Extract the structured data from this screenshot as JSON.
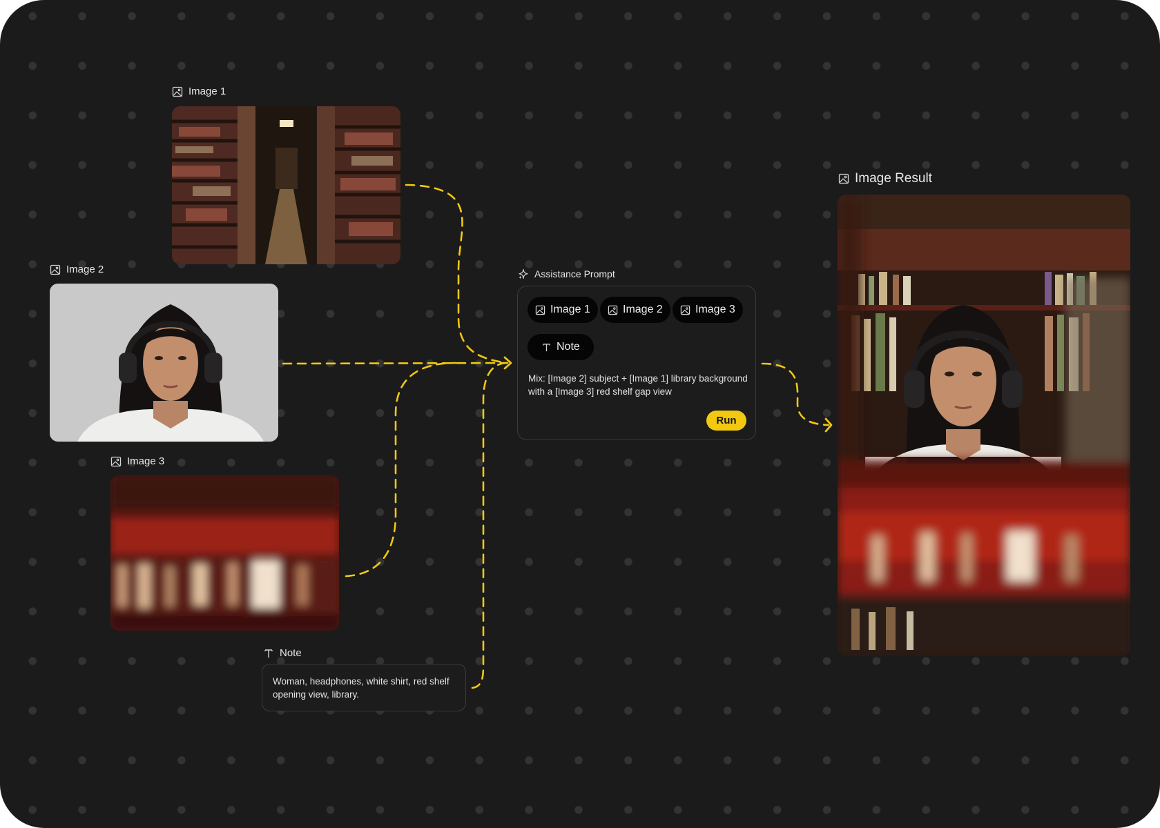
{
  "colors": {
    "canvas": "#1b1b1b",
    "dot": "#333333",
    "wire": "#f2c811",
    "accent": "#f2c811",
    "card_border": "#3c3c3c"
  },
  "nodes": {
    "image1": {
      "label": "Image 1",
      "icon": "image-icon"
    },
    "image2": {
      "label": "Image 2",
      "icon": "image-icon"
    },
    "image3": {
      "label": "Image 3",
      "icon": "image-icon"
    },
    "note": {
      "label": "Note",
      "icon": "text-icon",
      "text": "Woman, headphones, white shirt, red shelf opening view, library."
    },
    "prompt": {
      "label": "Assistance Prompt",
      "icon": "sparkle-icon",
      "chips": [
        {
          "label": "Image 1",
          "icon": "image-icon"
        },
        {
          "label": "Image 2",
          "icon": "image-icon"
        },
        {
          "label": "Image 3",
          "icon": "image-icon"
        },
        {
          "label": "Note",
          "icon": "text-icon"
        }
      ],
      "text": "Mix: [Image 2] subject + [Image 1] library background with a [Image 3] red shelf gap view",
      "run_label": "Run"
    },
    "result": {
      "label": "Image Result",
      "icon": "image-icon"
    }
  }
}
